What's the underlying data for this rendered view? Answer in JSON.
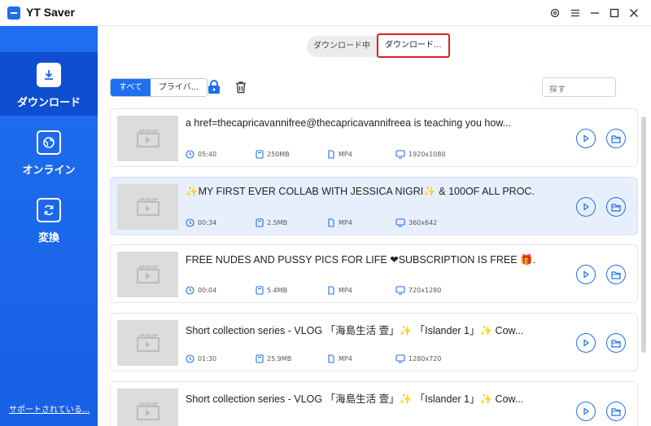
{
  "app": {
    "title": "YT Saver"
  },
  "sidebar": {
    "items": [
      {
        "label": "ダウンロード",
        "icon": "download-icon"
      },
      {
        "label": "オンライン",
        "icon": "globe-icon"
      },
      {
        "label": "変換",
        "icon": "convert-icon"
      }
    ],
    "support": "サポートされている..."
  },
  "tabs": {
    "downloading": "ダウンロード中",
    "downloaded": "ダウンロード..."
  },
  "toolbar": {
    "all": "すべて",
    "private": "プライバ...",
    "search_placeholder": "探す"
  },
  "videos": [
    {
      "title": "a href=thecapricavannifree@thecapricavannifreea is teaching you how...",
      "duration": "05:40",
      "size": "250MB",
      "format": "MP4",
      "resolution": "1920x1080"
    },
    {
      "title": "✨MY FIRST EVER COLLAB WITH JESSICA NIGRI✨ & 100OF ALL PROC...",
      "duration": "00:34",
      "size": "2.5MB",
      "format": "MP4",
      "resolution": "360x642"
    },
    {
      "title": "FREE NUDES AND PUSSY PICS FOR LIFE ❤SUBSCRIPTION IS FREE 🎁...",
      "duration": "00:04",
      "size": "5.4MB",
      "format": "MP4",
      "resolution": "720x1280"
    },
    {
      "title": "Short collection series - VLOG 「海島生活 壹」✨ 「Islander 1」✨ Cow...",
      "duration": "01:30",
      "size": "25.9MB",
      "format": "MP4",
      "resolution": "1280x720"
    },
    {
      "title": "Short collection series - VLOG 「海島生活 壹」✨ 「Islander 1」✨ Cow...",
      "duration": "",
      "size": "",
      "format": "",
      "resolution": ""
    }
  ],
  "colors": {
    "accent": "#1f6ff0",
    "highlight_row": "#e8effc",
    "tab_outline": "#e02020"
  }
}
